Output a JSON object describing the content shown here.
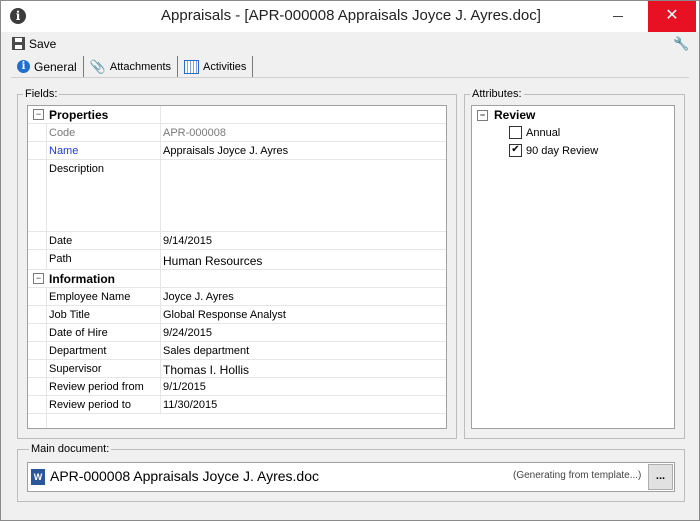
{
  "window": {
    "title": "Appraisals - [APR-000008 Appraisals Joyce J. Ayres.doc]"
  },
  "toolbar": {
    "save_label": "Save"
  },
  "tabs": [
    {
      "label": "General",
      "icon": "info-icon",
      "active": true
    },
    {
      "label": "Attachments",
      "icon": "paperclip-icon",
      "active": false
    },
    {
      "label": "Activities",
      "icon": "calendar-icon",
      "active": false
    }
  ],
  "fields": {
    "label": "Fields:",
    "categories": {
      "properties": "Properties",
      "information": "Information"
    },
    "rows": {
      "code": {
        "label": "Code",
        "value": "APR-000008"
      },
      "name": {
        "label": "Name",
        "value": "Appraisals Joyce J. Ayres"
      },
      "description": {
        "label": "Description",
        "value": ""
      },
      "date": {
        "label": "Date",
        "value": "9/14/2015"
      },
      "path": {
        "label": "Path",
        "value": "Human Resources"
      },
      "employee_name": {
        "label": "Employee Name",
        "value": "Joyce J. Ayres"
      },
      "job_title": {
        "label": "Job Title",
        "value": "Global Response Analyst"
      },
      "date_of_hire": {
        "label": "Date of Hire",
        "value": "9/24/2015"
      },
      "department": {
        "label": "Department",
        "value": "Sales department"
      },
      "supervisor": {
        "label": "Supervisor",
        "value": "Thomas I. Hollis"
      },
      "review_from": {
        "label": "Review period from",
        "value": "9/1/2015"
      },
      "review_to": {
        "label": "Review period to",
        "value": "11/30/2015"
      }
    }
  },
  "attributes": {
    "label": "Attributes:",
    "root": "Review",
    "items": [
      {
        "label": "Annual",
        "checked": false
      },
      {
        "label": "90 day Review",
        "checked": true
      }
    ]
  },
  "main_document": {
    "label": "Main document:",
    "filename": "APR-000008 Appraisals Joyce J. Ayres.doc",
    "status": "(Generating from template...)",
    "browse_label": "..."
  },
  "colors": {
    "close_button": "#e81123",
    "name_label": "#1f3ad6",
    "disabled_text": "#7a7a7a"
  }
}
